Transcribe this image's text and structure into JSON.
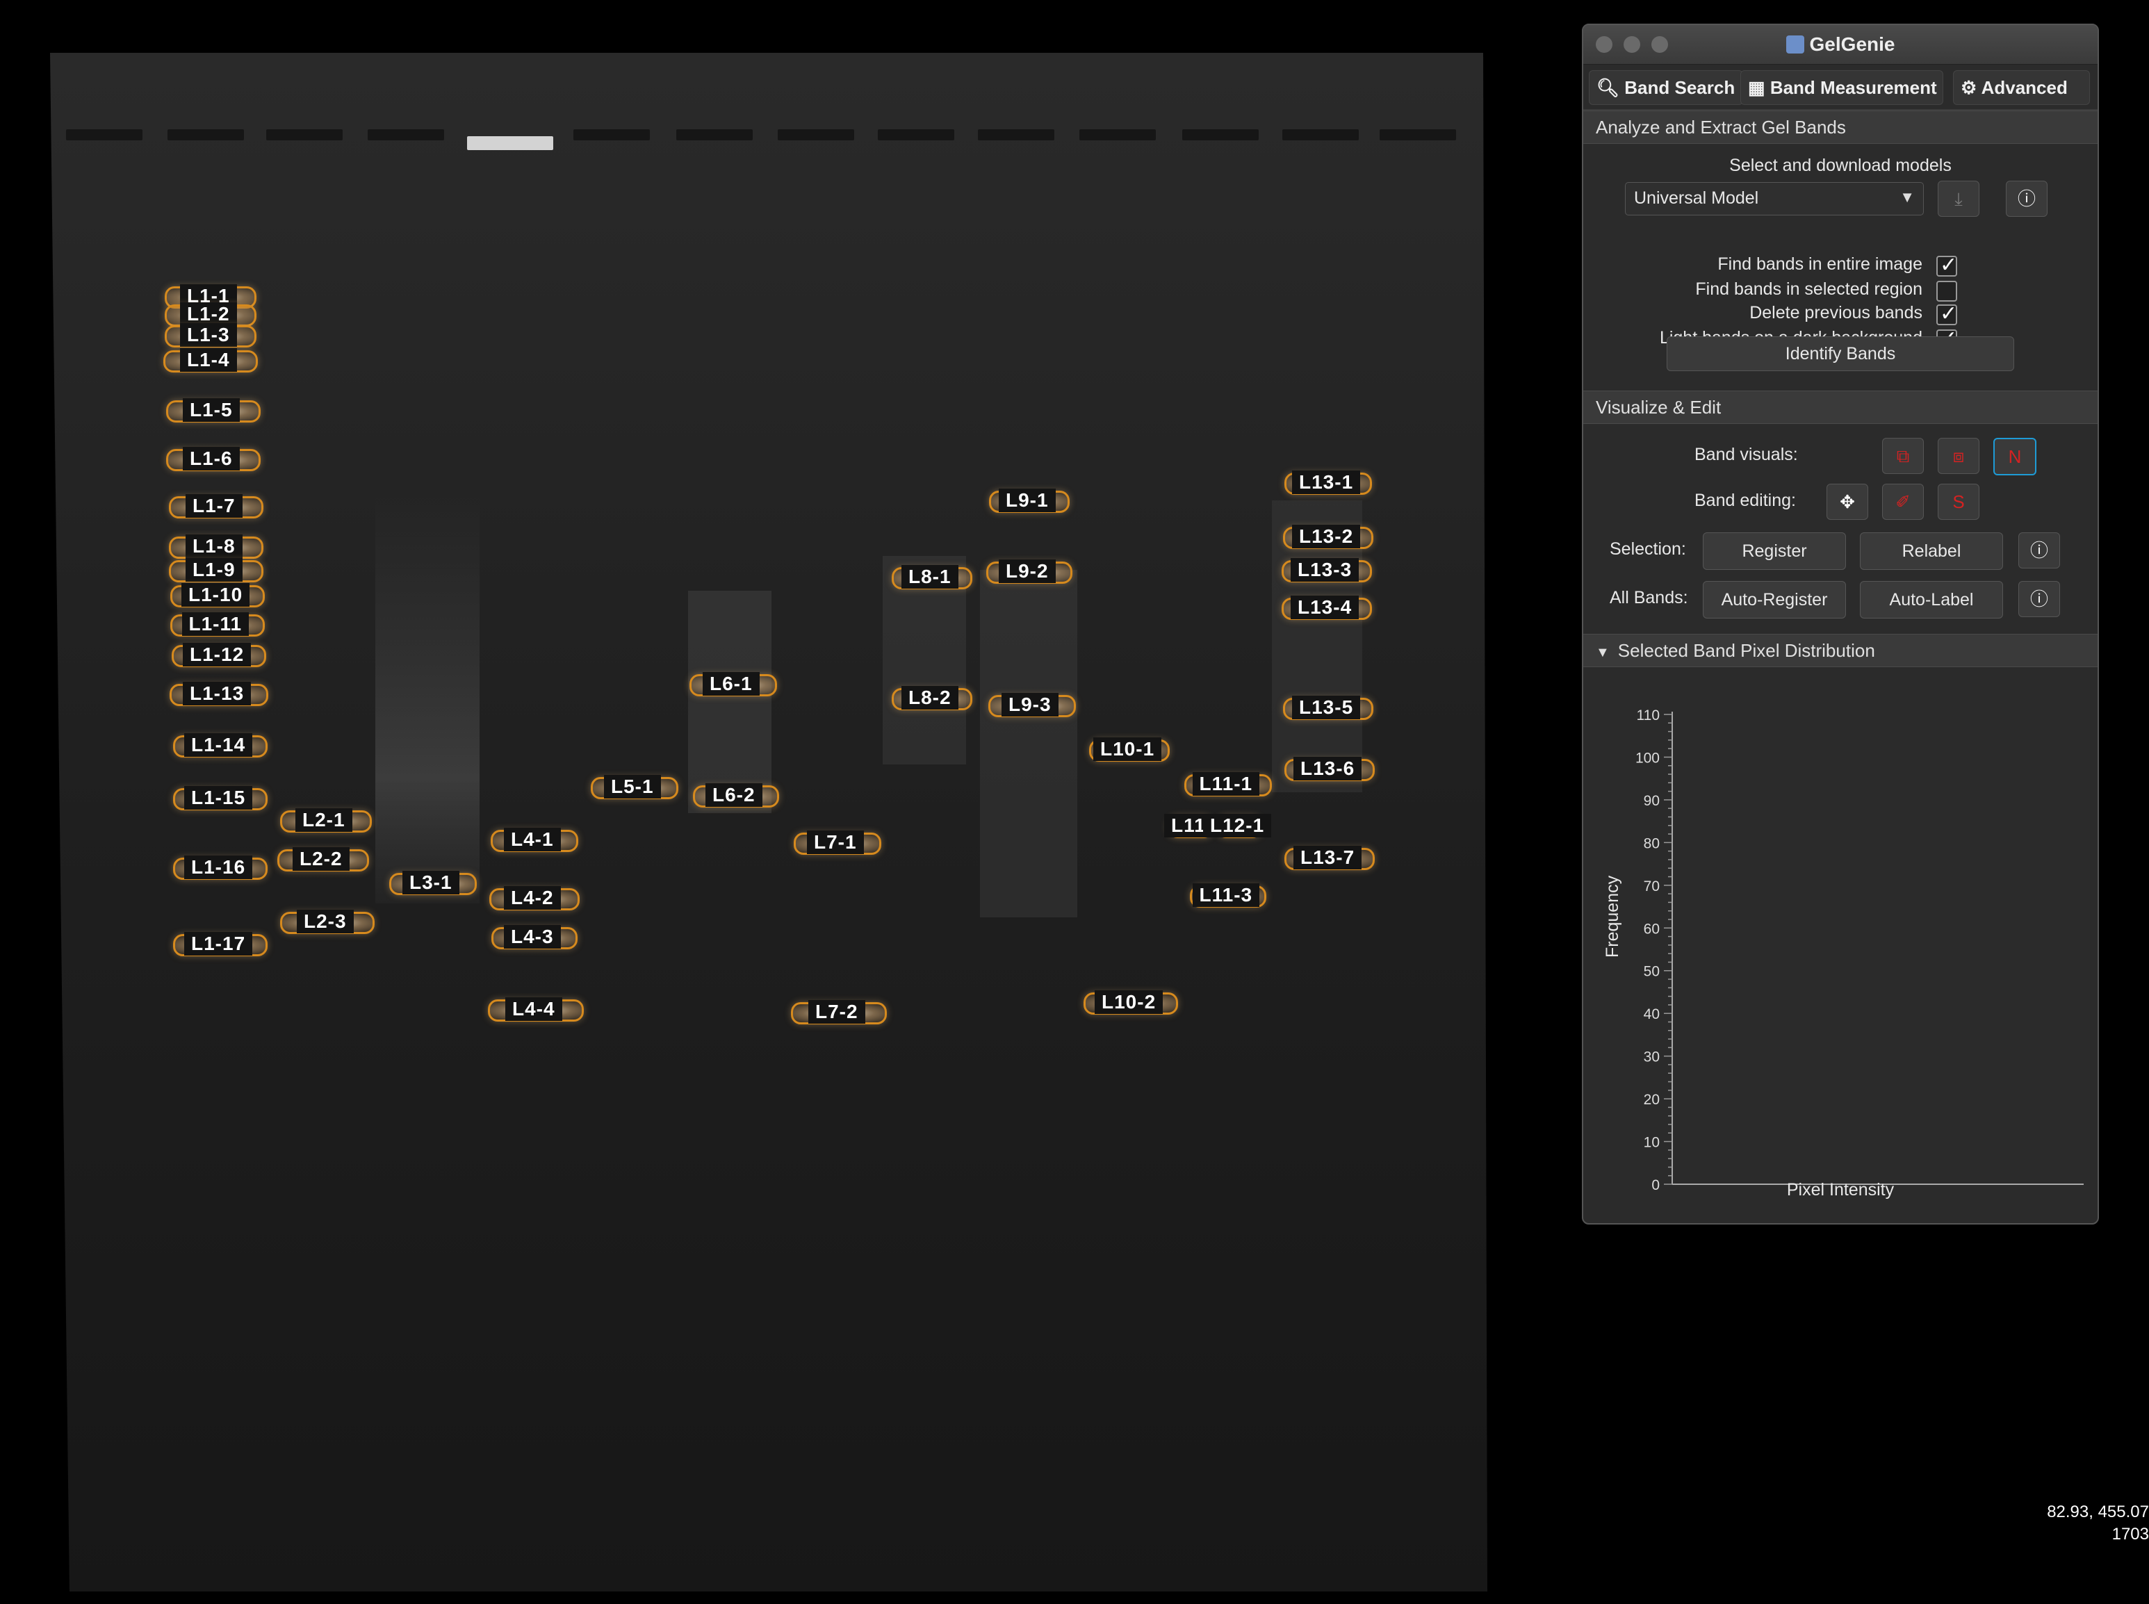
{
  "app_title": "GelGenie",
  "window_controls": [
    "close",
    "minimize",
    "zoom"
  ],
  "tabs": [
    {
      "label": "Band Search",
      "icon": "search-icon"
    },
    {
      "label": "Band Measurement",
      "icon": "table-icon"
    },
    {
      "label": "Advanced",
      "icon": "gear-icon"
    }
  ],
  "analyze": {
    "header": "Analyze and Extract Gel Bands",
    "select_label": "Select and download models",
    "model_value": "Universal Model",
    "options": [
      {
        "label": "Find bands in entire image",
        "checked": true
      },
      {
        "label": "Find bands in selected region",
        "checked": false
      },
      {
        "label": "Delete previous bands",
        "checked": true
      },
      {
        "label": "Light bands on a dark background",
        "checked": true
      }
    ],
    "identify_button": "Identify Bands"
  },
  "visualize": {
    "header": "Visualize & Edit",
    "band_visuals_label": "Band visuals:",
    "band_editing_label": "Band editing:",
    "visuals_n": "N",
    "editing_s": "S",
    "selection_label": "Selection:",
    "register": "Register",
    "relabel": "Relabel",
    "all_bands_label": "All Bands:",
    "auto_register": "Auto-Register",
    "auto_label": "Auto-Label"
  },
  "distribution": {
    "header": "Selected Band Pixel Distribution",
    "ylabel": "Frequency",
    "xlabel": "Pixel Intensity",
    "yticks": [
      "0",
      "10",
      "20",
      "30",
      "40",
      "50",
      "60",
      "70",
      "80",
      "90",
      "100",
      "110"
    ]
  },
  "coords": {
    "line1": "82.93, 455.07",
    "line2": "1703"
  },
  "band_labels": [
    "L1-1",
    "L1-2",
    "L1-3",
    "L1-4",
    "L1-5",
    "L1-6",
    "L1-7",
    "L1-8",
    "L1-9",
    "L1-10",
    "L1-11",
    "L1-12",
    "L1-13",
    "L1-14",
    "L1-15",
    "L1-16",
    "L1-17",
    "L2-1",
    "L2-2",
    "L2-3",
    "L3-1",
    "L4-1",
    "L4-2",
    "L4-3",
    "L4-4",
    "L5-1",
    "L6-1",
    "L6-2",
    "L7-1",
    "L7-2",
    "L8-1",
    "L8-2",
    "L9-1",
    "L9-2",
    "L9-3",
    "L10-1",
    "L10-2",
    "L11-1",
    "L11",
    "L12-1",
    "L11-3",
    "L13-1",
    "L13-2",
    "L13-3",
    "L13-4",
    "L13-5",
    "L13-6",
    "L13-7"
  ],
  "colors": {
    "band_outline": "#d68a1e",
    "active_blue": "#1e9bd6",
    "icon_red": "#d42222"
  }
}
